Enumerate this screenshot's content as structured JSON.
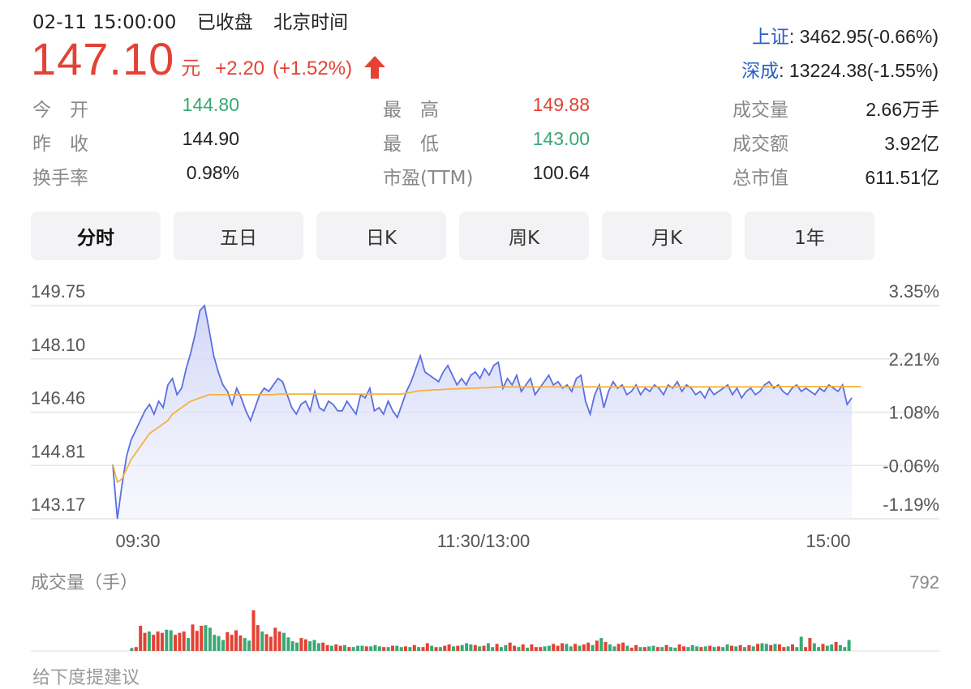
{
  "header": {
    "datetime": "02-11 15:00:00",
    "status": "已收盘",
    "timezone": "北京时间"
  },
  "quote": {
    "price": "147.10",
    "unit": "元",
    "change": "+2.20",
    "change_pct": "(+1.52%)",
    "direction": "up",
    "up_color": "#e34234",
    "down_color": "#3aa876"
  },
  "indices": [
    {
      "name": "上证",
      "value": ": 3462.95(-0.66%)"
    },
    {
      "name": "深成",
      "value": ": 13224.38(-1.55%)"
    }
  ],
  "stats": [
    [
      {
        "label": "今　开",
        "value": "144.80",
        "color": "green"
      },
      {
        "label": "最　高",
        "value": "149.88",
        "color": "red"
      },
      {
        "label": "成交量",
        "value": "2.66万手",
        "color": "dark"
      }
    ],
    [
      {
        "label": "昨　收",
        "value": "144.90",
        "color": "dark"
      },
      {
        "label": "最　低",
        "value": "143.00",
        "color": "green"
      },
      {
        "label": "成交额",
        "value": "3.92亿",
        "color": "dark"
      }
    ],
    [
      {
        "label": "换手率",
        "value": "0.98%",
        "color": "dark"
      },
      {
        "label": "市盈(TTM)",
        "value": "100.64",
        "color": "dark"
      },
      {
        "label": "总市值",
        "value": "611.51亿",
        "color": "dark"
      }
    ]
  ],
  "tabs": [
    "分时",
    "五日",
    "日K",
    "周K",
    "月K",
    "1年"
  ],
  "active_tab": "分时",
  "chart_data": {
    "type": "line",
    "y_left_ticks": [
      "149.75",
      "148.10",
      "146.46",
      "144.81",
      "143.17"
    ],
    "y_right_ticks": [
      "3.35%",
      "2.21%",
      "1.08%",
      "-0.06%",
      "-1.19%"
    ],
    "ylim": [
      143.17,
      149.75
    ],
    "x_ticks": [
      "09:30",
      "11:30/13:00",
      "15:00"
    ],
    "series": [
      {
        "role": "price",
        "color": "#5b6fe0",
        "values": [
          144.85,
          143.17,
          144.2,
          145.1,
          145.6,
          145.9,
          146.2,
          146.5,
          146.7,
          146.4,
          146.8,
          146.6,
          147.3,
          147.5,
          147.0,
          147.2,
          147.8,
          148.3,
          148.9,
          149.6,
          149.75,
          149.0,
          148.2,
          147.7,
          147.3,
          147.1,
          146.7,
          147.2,
          146.9,
          146.5,
          146.2,
          146.6,
          147.0,
          147.2,
          147.1,
          147.3,
          147.5,
          147.4,
          147.0,
          146.6,
          146.4,
          146.7,
          146.8,
          146.5,
          147.1,
          146.6,
          146.5,
          146.8,
          146.7,
          146.5,
          146.5,
          146.8,
          146.6,
          146.4,
          147.0,
          146.9,
          147.2,
          146.5,
          146.6,
          146.4,
          146.8,
          146.5,
          146.3,
          146.7,
          147.1,
          147.4,
          147.8,
          148.2,
          147.7,
          147.6,
          147.5,
          147.4,
          147.7,
          147.9,
          147.6,
          147.3,
          147.5,
          147.3,
          147.6,
          147.7,
          147.5,
          147.8,
          147.6,
          147.9,
          148.0,
          147.2,
          147.5,
          147.3,
          147.6,
          147.1,
          147.3,
          147.5,
          147.0,
          147.2,
          147.4,
          147.6,
          147.3,
          147.4,
          147.2,
          147.3,
          147.1,
          147.5,
          147.6,
          146.8,
          146.4,
          147.0,
          147.3,
          146.6,
          147.1,
          147.4,
          147.2,
          147.3,
          147.0,
          147.1,
          147.3,
          147.0,
          147.2,
          147.1,
          147.3,
          147.2,
          147.0,
          147.3,
          147.2,
          147.4,
          147.1,
          147.3,
          147.2,
          147.0,
          147.1,
          146.9,
          147.2,
          147.0,
          147.1,
          147.2,
          147.3,
          147.0,
          147.2,
          146.9,
          147.1,
          147.2,
          147.0,
          147.1,
          147.3,
          147.4,
          147.2,
          147.3,
          147.1,
          147.0,
          147.2,
          147.3,
          147.1,
          147.2,
          147.1,
          147.0,
          147.2,
          147.1,
          147.3,
          147.2,
          147.1,
          147.3,
          146.7,
          146.9
        ]
      },
      {
        "role": "average",
        "color": "#f2b33d",
        "values": [
          144.85,
          144.3,
          144.4,
          144.7,
          145.0,
          145.2,
          145.4,
          145.6,
          145.8,
          145.9,
          146.0,
          146.1,
          146.2,
          146.4,
          146.5,
          146.6,
          146.7,
          146.8,
          146.85,
          146.9,
          146.95,
          147.0,
          147.0,
          147.0,
          147.0,
          147.0,
          147.0,
          147.0,
          147.0,
          147.0,
          147.0,
          147.0,
          147.0,
          147.0,
          147.0,
          147.0,
          147.02,
          147.02,
          147.02,
          147.02,
          147.02,
          147.02,
          147.02,
          147.02,
          147.02,
          147.02,
          147.02,
          147.02,
          147.02,
          147.02,
          147.02,
          147.02,
          147.02,
          147.02,
          147.02,
          147.02,
          147.02,
          147.02,
          147.02,
          147.02,
          147.02,
          147.02,
          147.02,
          147.02,
          147.05,
          147.07,
          147.1,
          147.12,
          147.13,
          147.14,
          147.15,
          147.15,
          147.16,
          147.17,
          147.18,
          147.18,
          147.19,
          147.19,
          147.2,
          147.2,
          147.21,
          147.21,
          147.22,
          147.23,
          147.24,
          147.24,
          147.24,
          147.24,
          147.24,
          147.24,
          147.24,
          147.24,
          147.24,
          147.24,
          147.24,
          147.24,
          147.24,
          147.24,
          147.24,
          147.24,
          147.24,
          147.24,
          147.24,
          147.24,
          147.24,
          147.24,
          147.24,
          147.24,
          147.24,
          147.24,
          147.24,
          147.24,
          147.24,
          147.24,
          147.24,
          147.24,
          147.24,
          147.24,
          147.24,
          147.24,
          147.24,
          147.24,
          147.24,
          147.24,
          147.24,
          147.24,
          147.24,
          147.24,
          147.24,
          147.24,
          147.24,
          147.24,
          147.24,
          147.24,
          147.24,
          147.24,
          147.24,
          147.24,
          147.24,
          147.24,
          147.24,
          147.24,
          147.24,
          147.25,
          147.25,
          147.25,
          147.25,
          147.25,
          147.25,
          147.25,
          147.25,
          147.25,
          147.25,
          147.25,
          147.25,
          147.25,
          147.25,
          147.25,
          147.25,
          147.25,
          147.25,
          147.25,
          147.25,
          147.25
        ]
      }
    ],
    "volume": {
      "label": "成交量（手）",
      "max_label": "792",
      "max": 792,
      "up_color": "#e34234",
      "down_color": "#3aa876",
      "flat_color": "#cccccc",
      "bars": [
        [
          0,
          "up"
        ],
        [
          0,
          "flat"
        ],
        [
          0,
          "flat"
        ],
        [
          0,
          "flat"
        ],
        [
          45,
          "down"
        ],
        [
          60,
          "up"
        ],
        [
          390,
          "up"
        ],
        [
          280,
          "up"
        ],
        [
          300,
          "down"
        ],
        [
          250,
          "up"
        ],
        [
          300,
          "up"
        ],
        [
          280,
          "up"
        ],
        [
          330,
          "down"
        ],
        [
          320,
          "down"
        ],
        [
          250,
          "up"
        ],
        [
          280,
          "up"
        ],
        [
          300,
          "up"
        ],
        [
          200,
          "down"
        ],
        [
          410,
          "up"
        ],
        [
          310,
          "up"
        ],
        [
          390,
          "up"
        ],
        [
          400,
          "down"
        ],
        [
          360,
          "down"
        ],
        [
          250,
          "down"
        ],
        [
          230,
          "down"
        ],
        [
          170,
          "down"
        ],
        [
          290,
          "up"
        ],
        [
          250,
          "up"
        ],
        [
          320,
          "up"
        ],
        [
          240,
          "up"
        ],
        [
          200,
          "down"
        ],
        [
          160,
          "down"
        ],
        [
          630,
          "up"
        ],
        [
          400,
          "up"
        ],
        [
          300,
          "down"
        ],
        [
          260,
          "up"
        ],
        [
          220,
          "up"
        ],
        [
          360,
          "up"
        ],
        [
          300,
          "up"
        ],
        [
          280,
          "down"
        ],
        [
          210,
          "down"
        ],
        [
          150,
          "down"
        ],
        [
          130,
          "down"
        ],
        [
          200,
          "up"
        ],
        [
          180,
          "up"
        ],
        [
          150,
          "down"
        ],
        [
          170,
          "down"
        ],
        [
          120,
          "down"
        ],
        [
          130,
          "up"
        ],
        [
          90,
          "up"
        ],
        [
          80,
          "down"
        ],
        [
          100,
          "up"
        ],
        [
          80,
          "up"
        ],
        [
          90,
          "down"
        ],
        [
          60,
          "up"
        ],
        [
          60,
          "down"
        ],
        [
          80,
          "down"
        ],
        [
          80,
          "down"
        ],
        [
          70,
          "up"
        ],
        [
          70,
          "down"
        ],
        [
          90,
          "down"
        ],
        [
          70,
          "down"
        ],
        [
          60,
          "up"
        ],
        [
          60,
          "down"
        ],
        [
          80,
          "up"
        ],
        [
          80,
          "down"
        ],
        [
          60,
          "down"
        ],
        [
          70,
          "up"
        ],
        [
          60,
          "down"
        ],
        [
          90,
          "up"
        ],
        [
          60,
          "down"
        ],
        [
          60,
          "up"
        ],
        [
          120,
          "up"
        ],
        [
          80,
          "down"
        ],
        [
          60,
          "up"
        ],
        [
          60,
          "down"
        ],
        [
          80,
          "up"
        ],
        [
          100,
          "up"
        ],
        [
          70,
          "down"
        ],
        [
          80,
          "up"
        ],
        [
          90,
          "down"
        ],
        [
          120,
          "down"
        ],
        [
          100,
          "down"
        ],
        [
          90,
          "up"
        ],
        [
          70,
          "down"
        ],
        [
          80,
          "up"
        ],
        [
          120,
          "down"
        ],
        [
          60,
          "down"
        ],
        [
          110,
          "up"
        ],
        [
          60,
          "down"
        ],
        [
          90,
          "down"
        ],
        [
          130,
          "up"
        ],
        [
          80,
          "up"
        ],
        [
          60,
          "down"
        ],
        [
          100,
          "up"
        ],
        [
          50,
          "down"
        ],
        [
          100,
          "up"
        ],
        [
          60,
          "up"
        ],
        [
          60,
          "up"
        ],
        [
          70,
          "down"
        ],
        [
          80,
          "down"
        ],
        [
          110,
          "up"
        ],
        [
          80,
          "up"
        ],
        [
          120,
          "up"
        ],
        [
          110,
          "down"
        ],
        [
          70,
          "down"
        ],
        [
          110,
          "up"
        ],
        [
          80,
          "down"
        ],
        [
          100,
          "up"
        ],
        [
          130,
          "up"
        ],
        [
          90,
          "down"
        ],
        [
          160,
          "up"
        ],
        [
          200,
          "down"
        ],
        [
          140,
          "up"
        ],
        [
          100,
          "down"
        ],
        [
          70,
          "down"
        ],
        [
          110,
          "up"
        ],
        [
          130,
          "up"
        ],
        [
          80,
          "down"
        ],
        [
          50,
          "up"
        ],
        [
          90,
          "up"
        ],
        [
          60,
          "down"
        ],
        [
          60,
          "up"
        ],
        [
          70,
          "down"
        ],
        [
          80,
          "down"
        ],
        [
          60,
          "up"
        ],
        [
          60,
          "down"
        ],
        [
          90,
          "up"
        ],
        [
          60,
          "down"
        ],
        [
          50,
          "down"
        ],
        [
          100,
          "up"
        ],
        [
          70,
          "up"
        ],
        [
          60,
          "down"
        ],
        [
          90,
          "down"
        ],
        [
          70,
          "down"
        ],
        [
          60,
          "up"
        ],
        [
          70,
          "down"
        ],
        [
          80,
          "up"
        ],
        [
          60,
          "down"
        ],
        [
          70,
          "up"
        ],
        [
          60,
          "down"
        ],
        [
          100,
          "down"
        ],
        [
          80,
          "up"
        ],
        [
          70,
          "down"
        ],
        [
          90,
          "up"
        ],
        [
          60,
          "down"
        ],
        [
          90,
          "up"
        ],
        [
          70,
          "down"
        ],
        [
          110,
          "up"
        ],
        [
          120,
          "down"
        ],
        [
          110,
          "down"
        ],
        [
          90,
          "up"
        ],
        [
          110,
          "down"
        ],
        [
          100,
          "up"
        ],
        [
          60,
          "up"
        ],
        [
          70,
          "down"
        ],
        [
          100,
          "up"
        ],
        [
          60,
          "down"
        ],
        [
          220,
          "down"
        ],
        [
          60,
          "up"
        ],
        [
          200,
          "up"
        ],
        [
          120,
          "down"
        ],
        [
          60,
          "down"
        ],
        [
          110,
          "up"
        ],
        [
          80,
          "down"
        ],
        [
          100,
          "down"
        ],
        [
          140,
          "up"
        ],
        [
          90,
          "down"
        ],
        [
          60,
          "down"
        ],
        [
          170,
          "down"
        ]
      ]
    }
  },
  "footer": {
    "note": "给下度提建议"
  }
}
